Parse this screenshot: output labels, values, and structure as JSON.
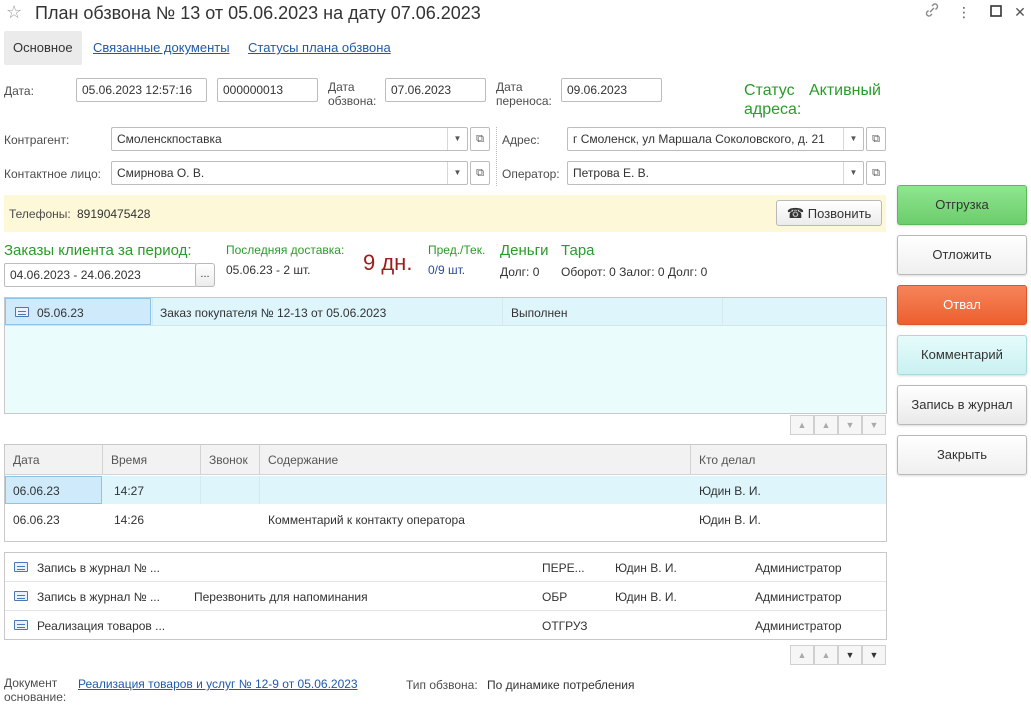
{
  "window": {
    "title": "План обзвона № 13 от 05.06.2023 на дату 07.06.2023",
    "icons": [
      "star-icon",
      "link-icon",
      "more-icon",
      "maximize-icon",
      "close-icon"
    ]
  },
  "tabs": [
    {
      "label": "Основное",
      "active": true
    },
    {
      "label": "Связанные документы",
      "active": false
    },
    {
      "label": "Статусы плана обзвона",
      "active": false
    }
  ],
  "form": {
    "date_label": "Дата:",
    "date_value": "05.06.2023 12:57:16",
    "number_value": "000000013",
    "call_date_label_1": "Дата",
    "call_date_label_2": "обзвона:",
    "call_date_value": "07.06.2023",
    "reschedule_label_1": "Дата",
    "reschedule_label_2": "переноса:",
    "reschedule_value": "09.06.2023",
    "address_status_label_1": "Статус",
    "address_status_label_2": "адреса:",
    "address_status_value": "Активный",
    "counterparty_label": "Контрагент:",
    "counterparty_value": "Смоленскпоставка",
    "address_label": "Адрес:",
    "address_value": "г Смоленск,  ул Маршала Соколовского,  д. 21",
    "contact_label": "Контактное лицо:",
    "contact_value": "Смирнова О. В.",
    "operator_label": "Оператор:",
    "operator_value": "Петрова Е. В."
  },
  "phones": {
    "label": "Телефоны:",
    "value": "89190475428",
    "call_button": "Позвонить"
  },
  "summary": {
    "orders_title": "Заказы клиента за период:",
    "period_value": "04.06.2023 - 24.06.2023",
    "period_button": "...",
    "last_delivery_label": "Последняя доставка:",
    "last_delivery_value": "05.06.23 - 2 шт.",
    "days_value": "9 дн.",
    "prev_cur_label": "Пред./Тек.",
    "prev_cur_value": "0/9 шт.",
    "money_title": "Деньги",
    "money_debt": "Долг: 0",
    "container_title": "Тара",
    "container_info": "Оборот: 0 Залог: 0 Долг: 0"
  },
  "orders_table": {
    "rows": [
      {
        "date": "05.06.23",
        "doc": "Заказ покупателя № 12-13 от 05.06.2023",
        "status": "Выполнен"
      }
    ]
  },
  "calls_table": {
    "headers": [
      "Дата",
      "Время",
      "Звонок",
      "Содержание",
      "Кто делал"
    ],
    "rows": [
      {
        "date": "06.06.23",
        "time": "14:27",
        "call": "",
        "content": "",
        "who": "Юдин В. И."
      },
      {
        "date": "06.06.23",
        "time": "14:26",
        "call": "",
        "content": "Комментарий к контакту оператора",
        "who": "Юдин В. И."
      }
    ]
  },
  "journal_table": {
    "rows": [
      {
        "doc": "Запись в журнал № ...",
        "note": "",
        "code": "ПЕРЕ...",
        "who": "Юдин В. И.",
        "role": "Администратор"
      },
      {
        "doc": "Запись в журнал № ...",
        "note": "Перезвонить для напоминания",
        "code": "ОБР",
        "who": "Юдин В. И.",
        "role": "Администратор"
      },
      {
        "doc": "Реализация товаров ...",
        "note": "",
        "code": "ОТГРУЗ",
        "who": "",
        "role": "Администратор"
      }
    ]
  },
  "footer": {
    "basis_label_1": "Документ",
    "basis_label_2": "основание:",
    "basis_link": "Реализация товаров и услуг № 12-9 от 05.06.2023",
    "call_type_label": "Тип обзвона:",
    "call_type_value": "По динамике потребления"
  },
  "side_buttons": {
    "ship": "Отгрузка",
    "postpone": "Отложить",
    "refuse": "Отвал",
    "comment": "Комментарий",
    "journal": "Запись в журнал",
    "close": "Закрыть"
  },
  "colors": {
    "accent_green": "#2a9b2a",
    "ship_button": "#7bd97b",
    "refuse_button": "#f0663a",
    "comment_button": "#d6f7f7",
    "days_red": "#9b1c1c",
    "selected_row": "#d8f0fb"
  }
}
